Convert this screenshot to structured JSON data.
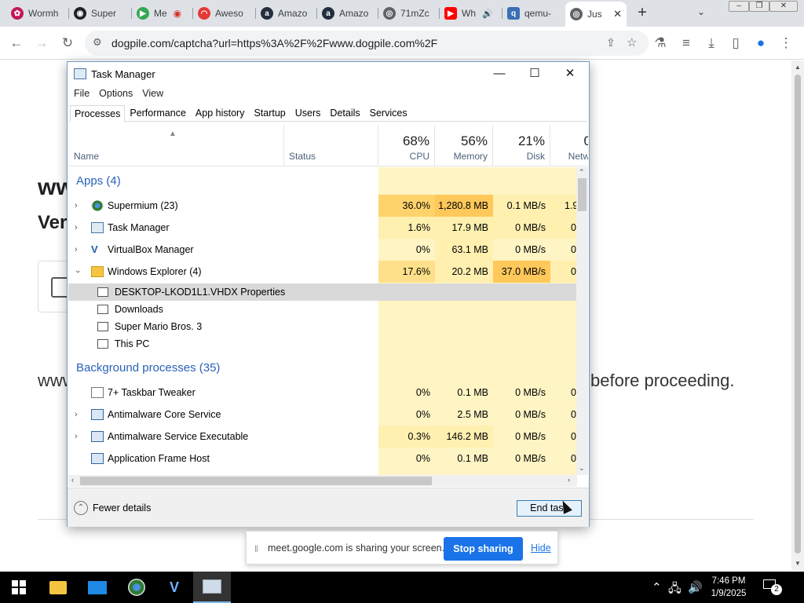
{
  "browser": {
    "tabs": [
      {
        "label": "Wormh",
        "icon": "wormhole-icon",
        "color": "#c2185b"
      },
      {
        "label": "Super",
        "icon": "supermium-icon",
        "color": "#202124"
      },
      {
        "label": "Me",
        "icon": "meet-icon",
        "color": "#34a853"
      },
      {
        "label": "Aweso",
        "icon": "awesome-icon",
        "color": "#e53935"
      },
      {
        "label": "Amazo",
        "icon": "amazon-icon",
        "color": "#232f3e"
      },
      {
        "label": "Amazo",
        "icon": "amazon-icon",
        "color": "#232f3e"
      },
      {
        "label": "71mZc",
        "icon": "globe-icon",
        "color": "#5f6368"
      },
      {
        "label": "Wh",
        "icon": "youtube-icon",
        "color": "#ff0000"
      },
      {
        "label": "qemu-",
        "icon": "qemu-icon",
        "color": "#3c6fb4"
      },
      {
        "label": "Jus",
        "icon": "globe-icon",
        "color": "#5f6368"
      }
    ],
    "url": "dogpile.com/captcha?url=https%3A%2F%2Fwww.dogpile.com%2F"
  },
  "page": {
    "heading_fragment": "ww",
    "subheading_fragment": "Veri",
    "text_left": "www",
    "text_right": "before proceeding."
  },
  "task_manager": {
    "title": "Task Manager",
    "menu": [
      "File",
      "Options",
      "View"
    ],
    "tabs": [
      "Processes",
      "Performance",
      "App history",
      "Startup",
      "Users",
      "Details",
      "Services"
    ],
    "columns": {
      "name": "Name",
      "status": "Status",
      "cpu": {
        "pct": "68%",
        "label": "CPU"
      },
      "memory": {
        "pct": "56%",
        "label": "Memory"
      },
      "disk": {
        "pct": "21%",
        "label": "Disk"
      },
      "network": {
        "pct": "0",
        "label": "Netw"
      }
    },
    "groups": {
      "apps": "Apps (4)",
      "background": "Background processes (35)"
    },
    "apps": [
      {
        "name": "Supermium (23)",
        "cpu": "36.0%",
        "mem": "1,280.8 MB",
        "disk": "0.1 MB/s",
        "net": "1.9"
      },
      {
        "name": "Task Manager",
        "cpu": "1.6%",
        "mem": "17.9 MB",
        "disk": "0 MB/s",
        "net": "0"
      },
      {
        "name": "VirtualBox Manager",
        "cpu": "0%",
        "mem": "63.1 MB",
        "disk": "0 MB/s",
        "net": "0"
      },
      {
        "name": "Windows Explorer (4)",
        "cpu": "17.6%",
        "mem": "20.2 MB",
        "disk": "37.0 MB/s",
        "net": "0"
      }
    ],
    "explorer_children": [
      "DESKTOP-LKOD1L1.VHDX Properties",
      "Downloads",
      "Super Mario Bros. 3",
      "This PC"
    ],
    "background": [
      {
        "name": "7+ Taskbar Tweaker",
        "cpu": "0%",
        "mem": "0.1 MB",
        "disk": "0 MB/s",
        "net": "0"
      },
      {
        "name": "Antimalware Core Service",
        "cpu": "0%",
        "mem": "2.5 MB",
        "disk": "0 MB/s",
        "net": "0"
      },
      {
        "name": "Antimalware Service Executable",
        "cpu": "0.3%",
        "mem": "146.2 MB",
        "disk": "0 MB/s",
        "net": "0"
      },
      {
        "name": "Application Frame Host",
        "cpu": "0%",
        "mem": "0.1 MB",
        "disk": "0 MB/s",
        "net": "0"
      }
    ],
    "fewer_details": "Fewer details",
    "end_task": "End task"
  },
  "sharing_bar": {
    "message": "meet.google.com is sharing your screen.",
    "stop": "Stop sharing",
    "hide": "Hide"
  },
  "taskbar": {
    "time": "7:46 PM",
    "date": "1/9/2025",
    "notification_count": "2"
  }
}
